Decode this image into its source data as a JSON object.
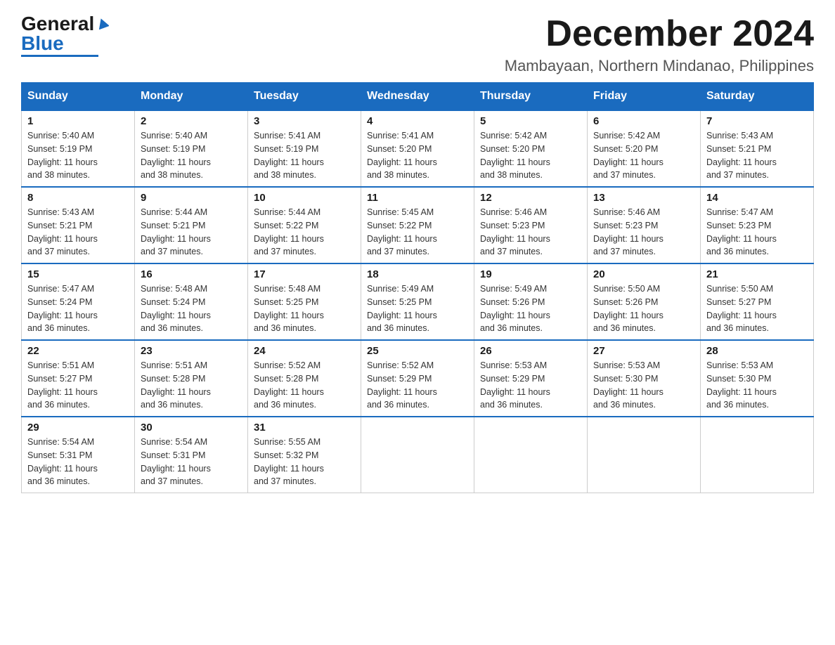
{
  "header": {
    "logo_general": "General",
    "logo_blue": "Blue",
    "month_title": "December 2024",
    "location": "Mambayaan, Northern Mindanao, Philippines"
  },
  "days_of_week": [
    "Sunday",
    "Monday",
    "Tuesday",
    "Wednesday",
    "Thursday",
    "Friday",
    "Saturday"
  ],
  "weeks": [
    [
      {
        "day": "1",
        "sunrise": "5:40 AM",
        "sunset": "5:19 PM",
        "daylight": "11 hours and 38 minutes."
      },
      {
        "day": "2",
        "sunrise": "5:40 AM",
        "sunset": "5:19 PM",
        "daylight": "11 hours and 38 minutes."
      },
      {
        "day": "3",
        "sunrise": "5:41 AM",
        "sunset": "5:19 PM",
        "daylight": "11 hours and 38 minutes."
      },
      {
        "day": "4",
        "sunrise": "5:41 AM",
        "sunset": "5:20 PM",
        "daylight": "11 hours and 38 minutes."
      },
      {
        "day": "5",
        "sunrise": "5:42 AM",
        "sunset": "5:20 PM",
        "daylight": "11 hours and 38 minutes."
      },
      {
        "day": "6",
        "sunrise": "5:42 AM",
        "sunset": "5:20 PM",
        "daylight": "11 hours and 37 minutes."
      },
      {
        "day": "7",
        "sunrise": "5:43 AM",
        "sunset": "5:21 PM",
        "daylight": "11 hours and 37 minutes."
      }
    ],
    [
      {
        "day": "8",
        "sunrise": "5:43 AM",
        "sunset": "5:21 PM",
        "daylight": "11 hours and 37 minutes."
      },
      {
        "day": "9",
        "sunrise": "5:44 AM",
        "sunset": "5:21 PM",
        "daylight": "11 hours and 37 minutes."
      },
      {
        "day": "10",
        "sunrise": "5:44 AM",
        "sunset": "5:22 PM",
        "daylight": "11 hours and 37 minutes."
      },
      {
        "day": "11",
        "sunrise": "5:45 AM",
        "sunset": "5:22 PM",
        "daylight": "11 hours and 37 minutes."
      },
      {
        "day": "12",
        "sunrise": "5:46 AM",
        "sunset": "5:23 PM",
        "daylight": "11 hours and 37 minutes."
      },
      {
        "day": "13",
        "sunrise": "5:46 AM",
        "sunset": "5:23 PM",
        "daylight": "11 hours and 37 minutes."
      },
      {
        "day": "14",
        "sunrise": "5:47 AM",
        "sunset": "5:23 PM",
        "daylight": "11 hours and 36 minutes."
      }
    ],
    [
      {
        "day": "15",
        "sunrise": "5:47 AM",
        "sunset": "5:24 PM",
        "daylight": "11 hours and 36 minutes."
      },
      {
        "day": "16",
        "sunrise": "5:48 AM",
        "sunset": "5:24 PM",
        "daylight": "11 hours and 36 minutes."
      },
      {
        "day": "17",
        "sunrise": "5:48 AM",
        "sunset": "5:25 PM",
        "daylight": "11 hours and 36 minutes."
      },
      {
        "day": "18",
        "sunrise": "5:49 AM",
        "sunset": "5:25 PM",
        "daylight": "11 hours and 36 minutes."
      },
      {
        "day": "19",
        "sunrise": "5:49 AM",
        "sunset": "5:26 PM",
        "daylight": "11 hours and 36 minutes."
      },
      {
        "day": "20",
        "sunrise": "5:50 AM",
        "sunset": "5:26 PM",
        "daylight": "11 hours and 36 minutes."
      },
      {
        "day": "21",
        "sunrise": "5:50 AM",
        "sunset": "5:27 PM",
        "daylight": "11 hours and 36 minutes."
      }
    ],
    [
      {
        "day": "22",
        "sunrise": "5:51 AM",
        "sunset": "5:27 PM",
        "daylight": "11 hours and 36 minutes."
      },
      {
        "day": "23",
        "sunrise": "5:51 AM",
        "sunset": "5:28 PM",
        "daylight": "11 hours and 36 minutes."
      },
      {
        "day": "24",
        "sunrise": "5:52 AM",
        "sunset": "5:28 PM",
        "daylight": "11 hours and 36 minutes."
      },
      {
        "day": "25",
        "sunrise": "5:52 AM",
        "sunset": "5:29 PM",
        "daylight": "11 hours and 36 minutes."
      },
      {
        "day": "26",
        "sunrise": "5:53 AM",
        "sunset": "5:29 PM",
        "daylight": "11 hours and 36 minutes."
      },
      {
        "day": "27",
        "sunrise": "5:53 AM",
        "sunset": "5:30 PM",
        "daylight": "11 hours and 36 minutes."
      },
      {
        "day": "28",
        "sunrise": "5:53 AM",
        "sunset": "5:30 PM",
        "daylight": "11 hours and 36 minutes."
      }
    ],
    [
      {
        "day": "29",
        "sunrise": "5:54 AM",
        "sunset": "5:31 PM",
        "daylight": "11 hours and 36 minutes."
      },
      {
        "day": "30",
        "sunrise": "5:54 AM",
        "sunset": "5:31 PM",
        "daylight": "11 hours and 37 minutes."
      },
      {
        "day": "31",
        "sunrise": "5:55 AM",
        "sunset": "5:32 PM",
        "daylight": "11 hours and 37 minutes."
      },
      null,
      null,
      null,
      null
    ]
  ],
  "labels": {
    "sunrise": "Sunrise:",
    "sunset": "Sunset:",
    "daylight": "Daylight:"
  }
}
